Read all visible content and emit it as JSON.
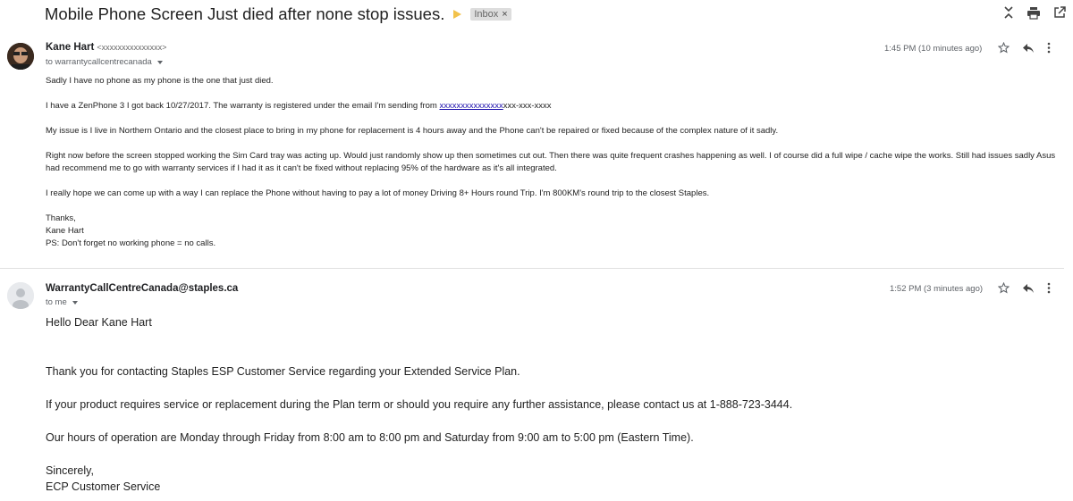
{
  "thread": {
    "subject": "Mobile Phone Screen Just died after none stop issues.",
    "label": "Inbox",
    "label_remove": "×"
  },
  "messages": [
    {
      "sender_name": "Kane Hart",
      "sender_email": "<xxxxxxxxxxxxxxx>",
      "to": "to warrantycallcentrecanada",
      "time": "1:45 PM (10 minutes ago)",
      "body": [
        "Sadly I have no phone as my phone is the one that just died.",
        "I have a ZenPhone 3 I got back 10/27/2017. The warranty is registered under the email I'm sending from",
        "My issue is I live in Northern Ontario and the closest place to bring in my phone for replacement is 4 hours away and the Phone can't be repaired or fixed because of the complex nature of it sadly.",
        "Right now before the screen stopped working the Sim Card tray was acting up. Would just randomly show up then sometimes cut out. Then there was quite frequent crashes happening as well. I of course did a full wipe / cache wipe the works. Still had issues sadly Asus had recommend me to go with warranty services if I had it as it can't be fixed without replacing 95% of the hardware as it's all integrated.",
        "I really hope we can come up with a way I can replace the Phone without having to pay a lot of money Driving 8+ Hours round Trip. I'm 800KM's round trip to the closest Staples."
      ],
      "email_link": "xxxxxxxxxxxxxxx",
      "phone_masked": "xxx-xxx-xxxx",
      "signoff": [
        "Thanks,",
        "Kane Hart",
        "PS: Don't forget no working phone = no calls."
      ]
    },
    {
      "sender_name": "WarrantyCallCentreCanada@staples.ca",
      "to": "to me",
      "time": "1:52 PM (3 minutes ago)",
      "greeting": "Hello Dear Kane Hart",
      "body": [
        "Thank you for contacting Staples ESP Customer Service regarding your Extended Service Plan.",
        "If your product requires service or replacement during the Plan term or should you require any further assistance, please contact us at 1-888-723-3444.",
        "Our hours of operation are Monday through Friday from 8:00 am to 8:00 pm and Saturday from 9:00 am to 5:00 pm (Eastern Time)."
      ],
      "signoff": [
        "Sincerely,",
        "ECP Customer Service"
      ]
    }
  ],
  "colors": {
    "important": "#f2c24b",
    "link": "#1a0dab",
    "muted": "#5f6368"
  }
}
